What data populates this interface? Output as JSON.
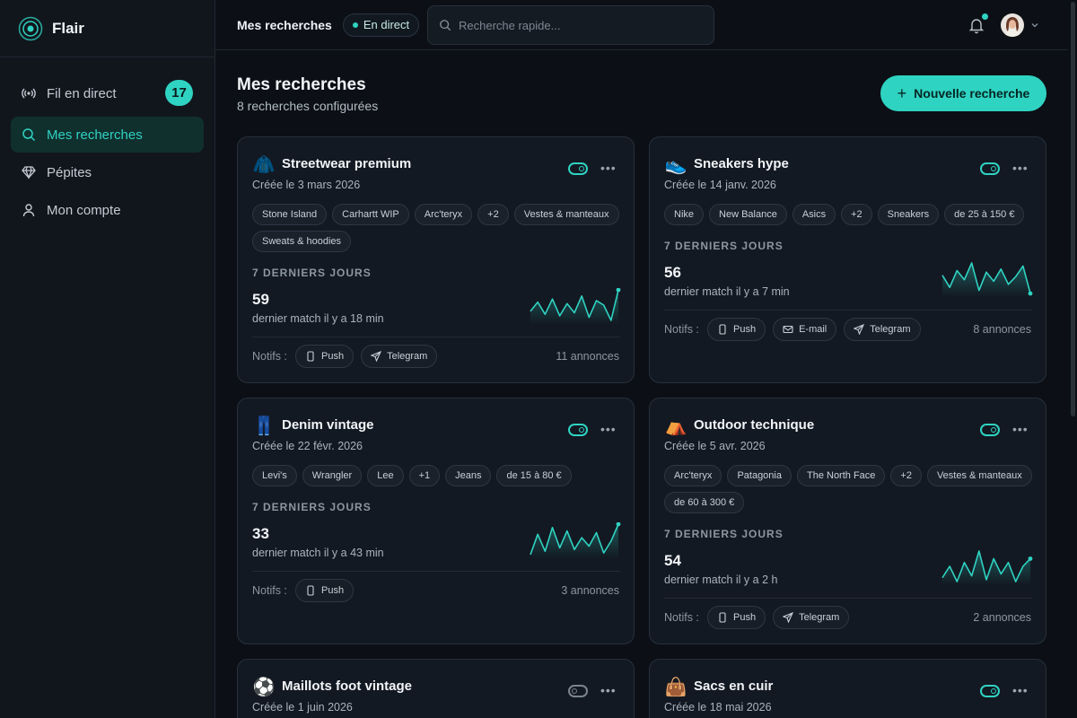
{
  "app": {
    "name": "Flair"
  },
  "sidebar": {
    "items": [
      {
        "label": "Fil en direct",
        "icon": "broadcast-icon",
        "badge": "17"
      },
      {
        "label": "Mes recherches",
        "icon": "search-icon",
        "active": true
      },
      {
        "label": "Pépites",
        "icon": "diamond-icon"
      },
      {
        "label": "Mon compte",
        "icon": "user-icon"
      }
    ]
  },
  "header": {
    "title": "Mes recherches",
    "live_label": "En direct",
    "search_placeholder": "Recherche rapide..."
  },
  "page": {
    "title": "Mes recherches",
    "subtitle": "8 recherches configurées",
    "new_button": "Nouvelle recherche"
  },
  "labels": {
    "section": "7 DERNIERS JOURS",
    "notifs": "Notifs :"
  },
  "colors": {
    "accent": "#2fd3c2",
    "background": "#0c1016",
    "card": "#131922"
  },
  "cards": [
    {
      "emoji": "🧥",
      "title": "Streetwear premium",
      "created": "Créée le 3 mars 2026",
      "enabled": true,
      "chips": [
        "Stone Island",
        "Carhartt WIP",
        "Arc'teryx",
        "+2",
        "Vestes & manteaux",
        "Sweats & hoodies"
      ],
      "count": "59",
      "last_match": "dernier match il y a 18 min",
      "spark": [
        6,
        12,
        4,
        14,
        3,
        11,
        5,
        16,
        2,
        13,
        10,
        0,
        20
      ],
      "notifs": [
        "Push",
        "Telegram"
      ],
      "annonces": "11 annonces"
    },
    {
      "emoji": "👟",
      "title": "Sneakers hype",
      "created": "Créée le 14 janv. 2026",
      "enabled": true,
      "chips": [
        "Nike",
        "New Balance",
        "Asics",
        "+2",
        "Sneakers",
        "de 25 à 150 €"
      ],
      "count": "56",
      "last_match": "dernier match il y a 7 min",
      "spark": [
        12,
        4,
        15,
        9,
        20,
        2,
        14,
        8,
        16,
        6,
        11,
        18,
        0
      ],
      "notifs": [
        "Push",
        "E-mail",
        "Telegram"
      ],
      "annonces": "8 annonces"
    },
    {
      "emoji": "👖",
      "title": "Denim vintage",
      "created": "Créée le 22 févr. 2026",
      "enabled": true,
      "chips": [
        "Levi's",
        "Wrangler",
        "Lee",
        "+1",
        "Jeans",
        "de 15 à 80 €"
      ],
      "count": "33",
      "last_match": "dernier match il y a 43 min",
      "spark": [
        2,
        14,
        4,
        18,
        6,
        16,
        5,
        12,
        7,
        15,
        3,
        10,
        20
      ],
      "notifs": [
        "Push"
      ],
      "annonces": "3 annonces"
    },
    {
      "emoji": "⛺",
      "title": "Outdoor technique",
      "created": "Créée le 5 avr. 2026",
      "enabled": true,
      "chips": [
        "Arc'teryx",
        "Patagonia",
        "The North Face",
        "+2",
        "Vestes & manteaux",
        "de 60 à 300 €"
      ],
      "count": "54",
      "last_match": "dernier match il y a 2 h",
      "spark": [
        4,
        10,
        2,
        12,
        5,
        18,
        3,
        14,
        6,
        12,
        2,
        10,
        14
      ],
      "notifs": [
        "Push",
        "Telegram"
      ],
      "annonces": "2 annonces"
    },
    {
      "emoji": "⚽",
      "title": "Maillots foot vintage",
      "created": "Créée le 1 juin 2026",
      "enabled": false,
      "chips": [],
      "count": "",
      "last_match": "",
      "spark": [],
      "notifs": [],
      "annonces": ""
    },
    {
      "emoji": "👜",
      "title": "Sacs en cuir",
      "created": "Créée le 18 mai 2026",
      "enabled": true,
      "chips": [],
      "count": "",
      "last_match": "",
      "spark": [],
      "notifs": [],
      "annonces": ""
    }
  ]
}
